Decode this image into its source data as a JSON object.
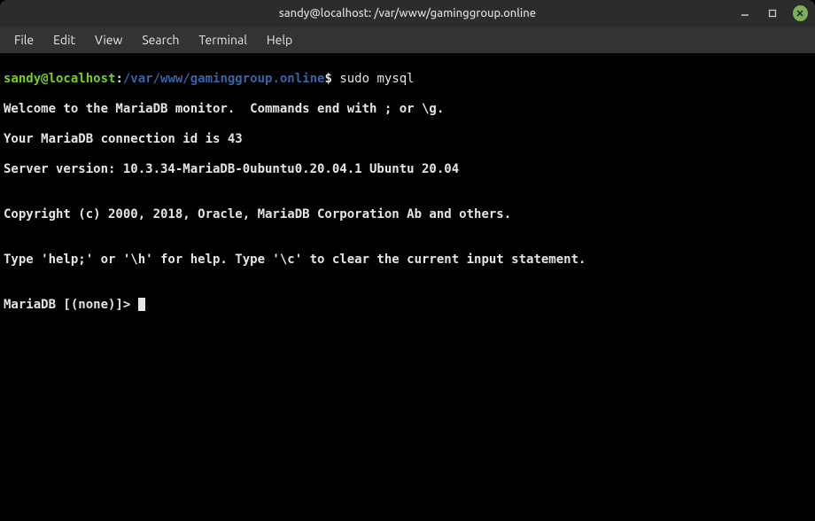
{
  "window": {
    "title": "sandy@localhost: /var/www/gaminggroup.online"
  },
  "menu": {
    "file": "File",
    "edit": "Edit",
    "view": "View",
    "search": "Search",
    "terminal": "Terminal",
    "help": "Help"
  },
  "prompt": {
    "user_host": "sandy@localhost",
    "sep": ":",
    "path": "/var/www/gaminggroup.online",
    "marker": "$",
    "command": "sudo mysql"
  },
  "output": {
    "l1": "Welcome to the MariaDB monitor.  Commands end with ; or \\g.",
    "l2": "Your MariaDB connection id is 43",
    "l3": "Server version: 10.3.34-MariaDB-0ubuntu0.20.04.1 Ubuntu 20.04",
    "l4": "",
    "l5": "Copyright (c) 2000, 2018, Oracle, MariaDB Corporation Ab and others.",
    "l6": "",
    "l7": "Type 'help;' or '\\h' for help. Type '\\c' to clear the current input statement.",
    "l8": "",
    "db_prompt": "MariaDB [(none)]> "
  }
}
